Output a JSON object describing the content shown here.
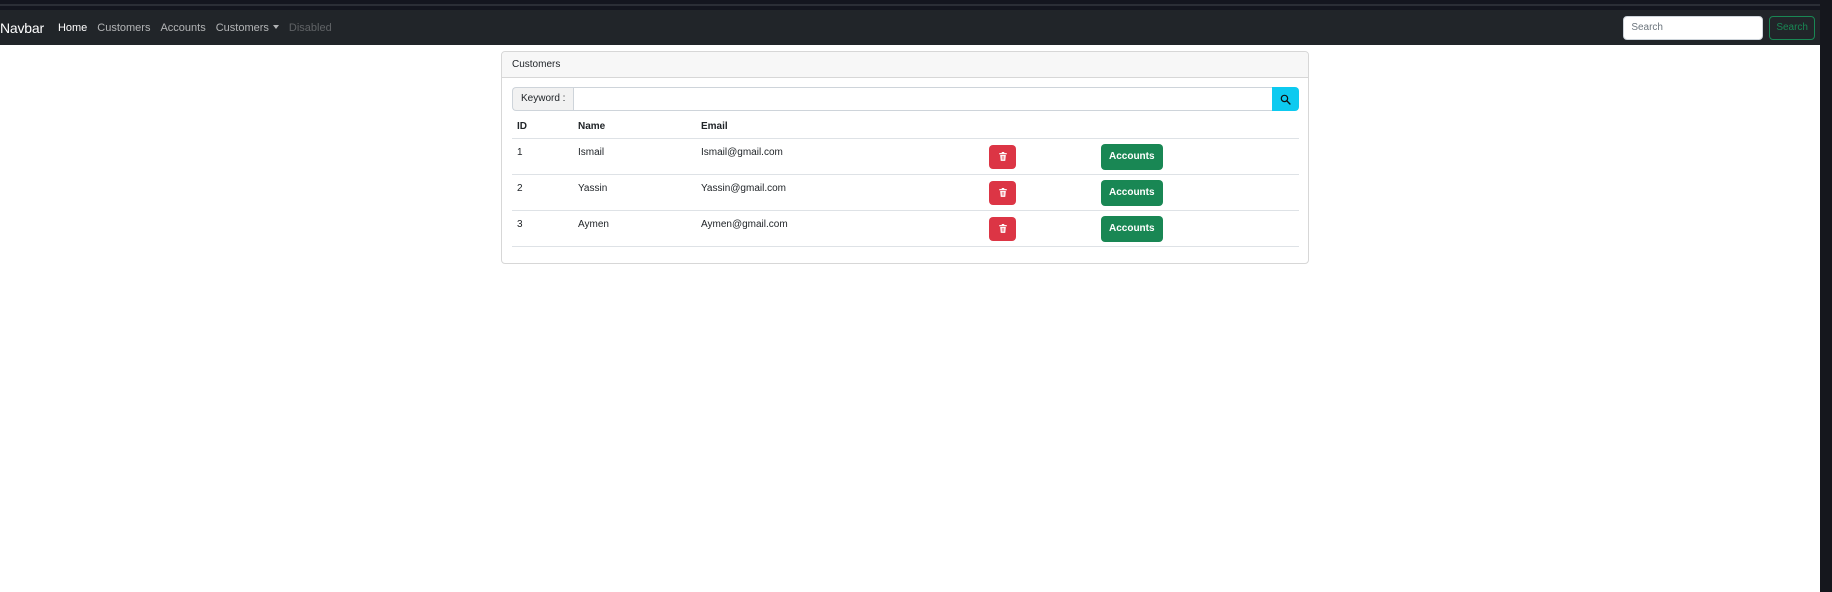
{
  "navbar": {
    "brand": "Navbar",
    "links": [
      {
        "label": "Home",
        "state": "active"
      },
      {
        "label": "Customers",
        "state": "normal"
      },
      {
        "label": "Accounts",
        "state": "normal"
      },
      {
        "label": "Customers",
        "state": "dropdown"
      },
      {
        "label": "Disabled",
        "state": "disabled"
      }
    ],
    "search": {
      "placeholder": "Search",
      "value": "",
      "button_label": "Search"
    }
  },
  "card": {
    "header": "Customers",
    "keyword_label": "Keyword :",
    "keyword_value": "",
    "search_icon": "search-icon",
    "table": {
      "columns": [
        "ID",
        "Name",
        "Email"
      ],
      "rows": [
        {
          "id": "1",
          "name": "Ismail",
          "email": "Ismail@gmail.com",
          "delete_icon": "trash-icon",
          "accounts_label": "Accounts"
        },
        {
          "id": "2",
          "name": "Yassin",
          "email": "Yassin@gmail.com",
          "delete_icon": "trash-icon",
          "accounts_label": "Accounts"
        },
        {
          "id": "3",
          "name": "Aymen",
          "email": "Aymen@gmail.com",
          "delete_icon": "trash-icon",
          "accounts_label": "Accounts"
        }
      ]
    }
  },
  "colors": {
    "navbar_bg": "#212529",
    "search_btn": "#198754",
    "info_btn": "#0dcaf0",
    "danger_btn": "#dc3545",
    "success_btn": "#198754"
  }
}
